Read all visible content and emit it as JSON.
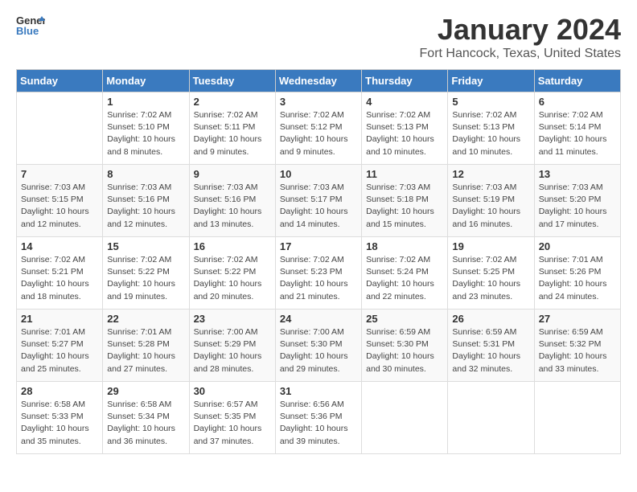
{
  "header": {
    "logo_general": "General",
    "logo_blue": "Blue",
    "title": "January 2024",
    "subtitle": "Fort Hancock, Texas, United States"
  },
  "days_of_week": [
    "Sunday",
    "Monday",
    "Tuesday",
    "Wednesday",
    "Thursday",
    "Friday",
    "Saturday"
  ],
  "weeks": [
    [
      {
        "day": "",
        "info": ""
      },
      {
        "day": "1",
        "info": "Sunrise: 7:02 AM\nSunset: 5:10 PM\nDaylight: 10 hours\nand 8 minutes."
      },
      {
        "day": "2",
        "info": "Sunrise: 7:02 AM\nSunset: 5:11 PM\nDaylight: 10 hours\nand 9 minutes."
      },
      {
        "day": "3",
        "info": "Sunrise: 7:02 AM\nSunset: 5:12 PM\nDaylight: 10 hours\nand 9 minutes."
      },
      {
        "day": "4",
        "info": "Sunrise: 7:02 AM\nSunset: 5:13 PM\nDaylight: 10 hours\nand 10 minutes."
      },
      {
        "day": "5",
        "info": "Sunrise: 7:02 AM\nSunset: 5:13 PM\nDaylight: 10 hours\nand 10 minutes."
      },
      {
        "day": "6",
        "info": "Sunrise: 7:02 AM\nSunset: 5:14 PM\nDaylight: 10 hours\nand 11 minutes."
      }
    ],
    [
      {
        "day": "7",
        "info": "Sunrise: 7:03 AM\nSunset: 5:15 PM\nDaylight: 10 hours\nand 12 minutes."
      },
      {
        "day": "8",
        "info": "Sunrise: 7:03 AM\nSunset: 5:16 PM\nDaylight: 10 hours\nand 12 minutes."
      },
      {
        "day": "9",
        "info": "Sunrise: 7:03 AM\nSunset: 5:16 PM\nDaylight: 10 hours\nand 13 minutes."
      },
      {
        "day": "10",
        "info": "Sunrise: 7:03 AM\nSunset: 5:17 PM\nDaylight: 10 hours\nand 14 minutes."
      },
      {
        "day": "11",
        "info": "Sunrise: 7:03 AM\nSunset: 5:18 PM\nDaylight: 10 hours\nand 15 minutes."
      },
      {
        "day": "12",
        "info": "Sunrise: 7:03 AM\nSunset: 5:19 PM\nDaylight: 10 hours\nand 16 minutes."
      },
      {
        "day": "13",
        "info": "Sunrise: 7:03 AM\nSunset: 5:20 PM\nDaylight: 10 hours\nand 17 minutes."
      }
    ],
    [
      {
        "day": "14",
        "info": "Sunrise: 7:02 AM\nSunset: 5:21 PM\nDaylight: 10 hours\nand 18 minutes."
      },
      {
        "day": "15",
        "info": "Sunrise: 7:02 AM\nSunset: 5:22 PM\nDaylight: 10 hours\nand 19 minutes."
      },
      {
        "day": "16",
        "info": "Sunrise: 7:02 AM\nSunset: 5:22 PM\nDaylight: 10 hours\nand 20 minutes."
      },
      {
        "day": "17",
        "info": "Sunrise: 7:02 AM\nSunset: 5:23 PM\nDaylight: 10 hours\nand 21 minutes."
      },
      {
        "day": "18",
        "info": "Sunrise: 7:02 AM\nSunset: 5:24 PM\nDaylight: 10 hours\nand 22 minutes."
      },
      {
        "day": "19",
        "info": "Sunrise: 7:02 AM\nSunset: 5:25 PM\nDaylight: 10 hours\nand 23 minutes."
      },
      {
        "day": "20",
        "info": "Sunrise: 7:01 AM\nSunset: 5:26 PM\nDaylight: 10 hours\nand 24 minutes."
      }
    ],
    [
      {
        "day": "21",
        "info": "Sunrise: 7:01 AM\nSunset: 5:27 PM\nDaylight: 10 hours\nand 25 minutes."
      },
      {
        "day": "22",
        "info": "Sunrise: 7:01 AM\nSunset: 5:28 PM\nDaylight: 10 hours\nand 27 minutes."
      },
      {
        "day": "23",
        "info": "Sunrise: 7:00 AM\nSunset: 5:29 PM\nDaylight: 10 hours\nand 28 minutes."
      },
      {
        "day": "24",
        "info": "Sunrise: 7:00 AM\nSunset: 5:30 PM\nDaylight: 10 hours\nand 29 minutes."
      },
      {
        "day": "25",
        "info": "Sunrise: 6:59 AM\nSunset: 5:30 PM\nDaylight: 10 hours\nand 30 minutes."
      },
      {
        "day": "26",
        "info": "Sunrise: 6:59 AM\nSunset: 5:31 PM\nDaylight: 10 hours\nand 32 minutes."
      },
      {
        "day": "27",
        "info": "Sunrise: 6:59 AM\nSunset: 5:32 PM\nDaylight: 10 hours\nand 33 minutes."
      }
    ],
    [
      {
        "day": "28",
        "info": "Sunrise: 6:58 AM\nSunset: 5:33 PM\nDaylight: 10 hours\nand 35 minutes."
      },
      {
        "day": "29",
        "info": "Sunrise: 6:58 AM\nSunset: 5:34 PM\nDaylight: 10 hours\nand 36 minutes."
      },
      {
        "day": "30",
        "info": "Sunrise: 6:57 AM\nSunset: 5:35 PM\nDaylight: 10 hours\nand 37 minutes."
      },
      {
        "day": "31",
        "info": "Sunrise: 6:56 AM\nSunset: 5:36 PM\nDaylight: 10 hours\nand 39 minutes."
      },
      {
        "day": "",
        "info": ""
      },
      {
        "day": "",
        "info": ""
      },
      {
        "day": "",
        "info": ""
      }
    ]
  ]
}
